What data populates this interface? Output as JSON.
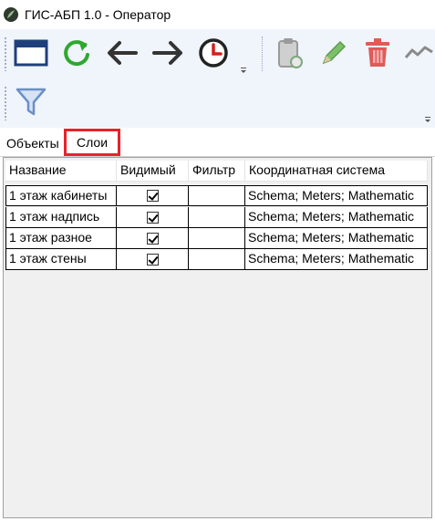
{
  "window": {
    "title": "ГИС-АБП 1.0 - Оператор"
  },
  "toolbar": {
    "buttons": [
      {
        "name": "window-icon",
        "color": "#1f3f7a"
      },
      {
        "name": "refresh-icon",
        "color": "#2ea82e"
      },
      {
        "name": "arrow-left-icon",
        "color": "#333333"
      },
      {
        "name": "arrow-right-icon",
        "color": "#333333"
      },
      {
        "name": "clock-icon",
        "color": "#d41f1f"
      },
      {
        "name": "clipboard-icon",
        "color": "#9a9a9a"
      },
      {
        "name": "pencil-icon",
        "color": "#7cc16a"
      },
      {
        "name": "trash-icon",
        "color": "#e05a5a"
      },
      {
        "name": "chart-line-icon",
        "color": "#8a8a8a"
      }
    ],
    "filter_icon": {
      "name": "filter-icon",
      "color": "#6b8fc7"
    }
  },
  "tabs": [
    {
      "label": "Объекты",
      "active": false
    },
    {
      "label": "Слои",
      "active": true
    }
  ],
  "table": {
    "headers": [
      "Название",
      "Видимый",
      "Фильтр",
      "Координатная система"
    ],
    "rows": [
      {
        "name": "1 этаж кабинеты",
        "visible": true,
        "filter": "",
        "coords": "Schema; Meters; Mathematic"
      },
      {
        "name": "1 этаж надпись",
        "visible": true,
        "filter": "",
        "coords": "Schema; Meters; Mathematic"
      },
      {
        "name": "1 этаж разное",
        "visible": true,
        "filter": "",
        "coords": "Schema; Meters; Mathematic"
      },
      {
        "name": "1 этаж стены",
        "visible": true,
        "filter": "",
        "coords": "Schema; Meters; Mathematic"
      }
    ]
  }
}
